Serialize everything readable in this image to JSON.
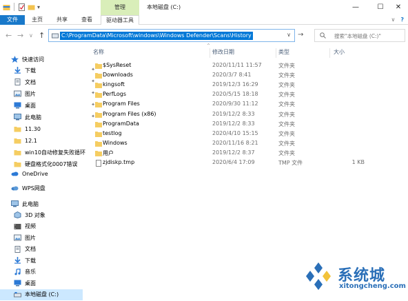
{
  "window": {
    "title": "本地磁盘 (C:)",
    "manage_tab": "管理",
    "controls": {
      "minimize": "—",
      "maximize": "☐",
      "close": "✕"
    }
  },
  "ribbon": {
    "tabs": [
      "文件",
      "主页",
      "共享",
      "查看",
      "驱动器工具"
    ],
    "right_chevron": "∨",
    "help": "?"
  },
  "address": {
    "path": "C:\\ProgramData\\Microsoft\\windows\\Windows Defender\\Scans\\History",
    "back": "←",
    "forward": "→",
    "recent": "∨",
    "up": "↑",
    "dropdown": "∨",
    "go": "→"
  },
  "search": {
    "placeholder": "搜索\"本地磁盘 (C:)\""
  },
  "nav": {
    "quick_access": "快速访问",
    "items": [
      {
        "label": "下载",
        "icon": "download-icon",
        "pinned": true
      },
      {
        "label": "文档",
        "icon": "document-icon",
        "pinned": true
      },
      {
        "label": "图片",
        "icon": "picture-icon",
        "pinned": true
      },
      {
        "label": "桌面",
        "icon": "desktop-icon",
        "pinned": true
      },
      {
        "label": "此电脑",
        "icon": "pc-icon",
        "pinned": true
      },
      {
        "label": "11.30",
        "icon": "folder-icon",
        "pinned": false
      },
      {
        "label": "12.1",
        "icon": "folder-icon",
        "pinned": false
      },
      {
        "label": "win10自动修复失败循环",
        "icon": "folder-icon",
        "pinned": false
      },
      {
        "label": "硬盘格式化0007错误",
        "icon": "folder-icon",
        "pinned": false
      }
    ],
    "onedrive": "OneDrive",
    "wps": "WPS网盘",
    "this_pc": "此电脑",
    "pc_items": [
      {
        "label": "3D 对象",
        "icon": "3d-objects-icon"
      },
      {
        "label": "视频",
        "icon": "video-icon"
      },
      {
        "label": "图片",
        "icon": "picture-icon"
      },
      {
        "label": "文档",
        "icon": "document-icon"
      },
      {
        "label": "下载",
        "icon": "download-icon"
      },
      {
        "label": "音乐",
        "icon": "music-icon"
      },
      {
        "label": "桌面",
        "icon": "desktop-icon"
      },
      {
        "label": "本地磁盘 (C:)",
        "icon": "drive-icon"
      }
    ],
    "pin_glyph": "✦"
  },
  "columns": {
    "name": "名称",
    "date": "修改日期",
    "type": "类型",
    "size": "大小",
    "sort_indicator": "^"
  },
  "files": [
    {
      "name": "$SysReset",
      "date": "2020/11/11 11:57",
      "type": "文件夹",
      "size": "",
      "kind": "folder"
    },
    {
      "name": "Downloads",
      "date": "2020/3/7 8:41",
      "type": "文件夹",
      "size": "",
      "kind": "folder"
    },
    {
      "name": "kingsoft",
      "date": "2019/12/3 16:29",
      "type": "文件夹",
      "size": "",
      "kind": "folder"
    },
    {
      "name": "PerfLogs",
      "date": "2020/5/15 18:18",
      "type": "文件夹",
      "size": "",
      "kind": "folder"
    },
    {
      "name": "Program Files",
      "date": "2020/9/30 11:12",
      "type": "文件夹",
      "size": "",
      "kind": "folder"
    },
    {
      "name": "Program Files (x86)",
      "date": "2019/12/2 8:33",
      "type": "文件夹",
      "size": "",
      "kind": "folder"
    },
    {
      "name": "ProgramData",
      "date": "2019/12/2 8:33",
      "type": "文件夹",
      "size": "",
      "kind": "folder"
    },
    {
      "name": "testlog",
      "date": "2020/4/10 15:15",
      "type": "文件夹",
      "size": "",
      "kind": "folder"
    },
    {
      "name": "Windows",
      "date": "2020/11/16 8:21",
      "type": "文件夹",
      "size": "",
      "kind": "folder"
    },
    {
      "name": "用户",
      "date": "2019/12/2 8:37",
      "type": "文件夹",
      "size": "",
      "kind": "folder"
    },
    {
      "name": "zjdiskp.tmp",
      "date": "2020/6/4 17:09",
      "type": "TMP 文件",
      "size": "1 KB",
      "kind": "file"
    }
  ],
  "watermark": {
    "brand": "系统城",
    "url": "xitongcheng.com"
  },
  "colors": {
    "accent": "#1979ca",
    "manage_tab": "#d9eeb9",
    "selection": "#0078d7",
    "folder": "#f5cd62",
    "nav_selected": "#cce8ff"
  }
}
